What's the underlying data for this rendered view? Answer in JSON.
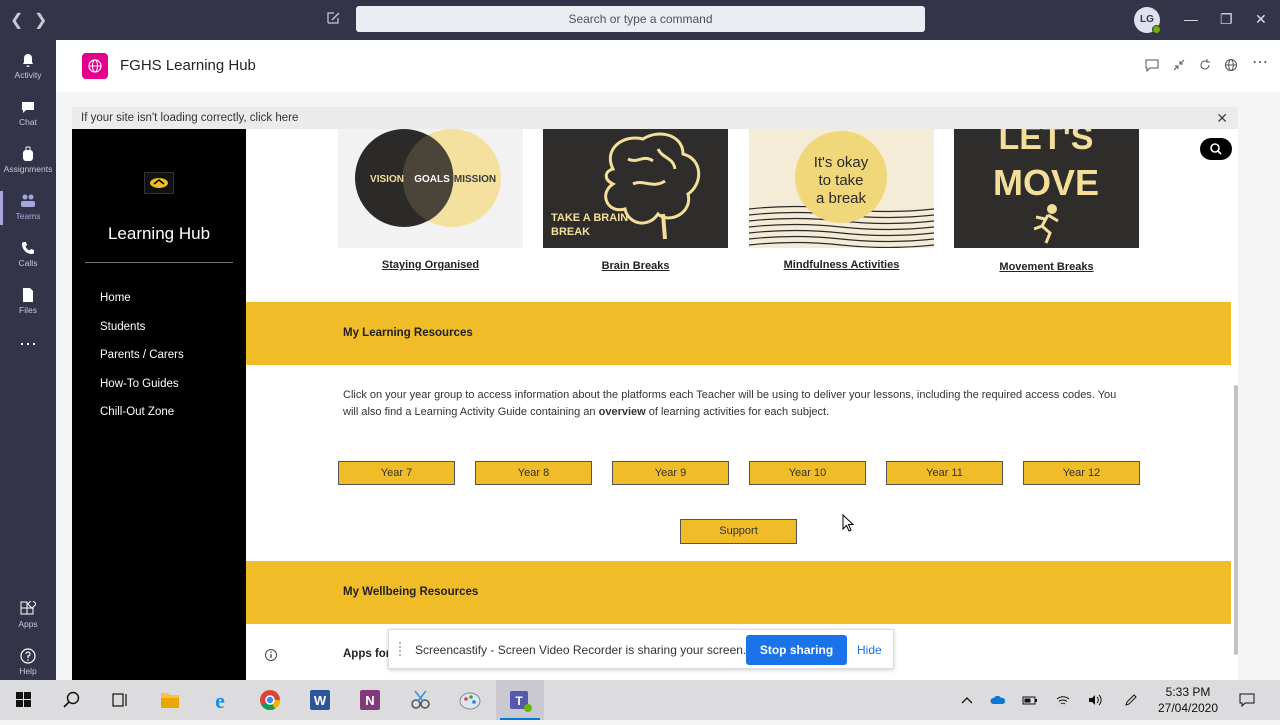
{
  "teams": {
    "search_placeholder": "Search or type a command",
    "avatar_initials": "LG",
    "rail": [
      {
        "label": "Activity"
      },
      {
        "label": "Chat"
      },
      {
        "label": "Assignments"
      },
      {
        "label": "Teams"
      },
      {
        "label": "Calls"
      },
      {
        "label": "Files"
      },
      {
        "label": "Apps"
      },
      {
        "label": "Help"
      }
    ],
    "app_title": "FGHS Learning Hub",
    "notice": "If your site isn't loading correctly, click here"
  },
  "site": {
    "brand": "Learning Hub",
    "nav": [
      "Home",
      "Students",
      "Parents / Carers",
      "How-To Guides",
      "Chill-Out Zone"
    ],
    "tiles": [
      {
        "caption": "Staying Organised",
        "venn_left": "VISION",
        "venn_mid": "GOALS",
        "venn_right": "MISSION"
      },
      {
        "caption": "Brain Breaks",
        "art_text_1": "TAKE A BRAIN",
        "art_text_2": "BREAK"
      },
      {
        "caption": "Mindfulness Activities",
        "art_text_1": "It's okay",
        "art_text_2": "to take",
        "art_text_3": "a break"
      },
      {
        "caption": "Movement Breaks",
        "art_text_1": "LET'S",
        "art_text_2": "MOVE"
      }
    ],
    "learning": {
      "title": "My Learning Resources",
      "intro_1": "Click on your year group to access information about the platforms each Teacher will be using to deliver your lessons, including the required access codes. You will also find a Learning Activity Guide containing an ",
      "intro_bold": "overview",
      "intro_2": " of learning activities for each subject.",
      "years": [
        "Year 7",
        "Year 8",
        "Year 9",
        "Year 10",
        "Year 11",
        "Year 12"
      ],
      "support": "Support"
    },
    "wellbeing": {
      "title": "My Wellbeing Resources",
      "apps_heading": "Apps for"
    }
  },
  "share_bar": {
    "text": "Screencastify - Screen Video Recorder is sharing your screen.",
    "stop": "Stop sharing",
    "hide": "Hide"
  },
  "taskbar": {
    "time": "5:33 PM",
    "date": "27/04/2020"
  },
  "colors": {
    "teams_dark": "#33344a",
    "accent_yellow": "#f0bc27",
    "app_logo": "#e3008c",
    "share_blue": "#1a73e8"
  }
}
